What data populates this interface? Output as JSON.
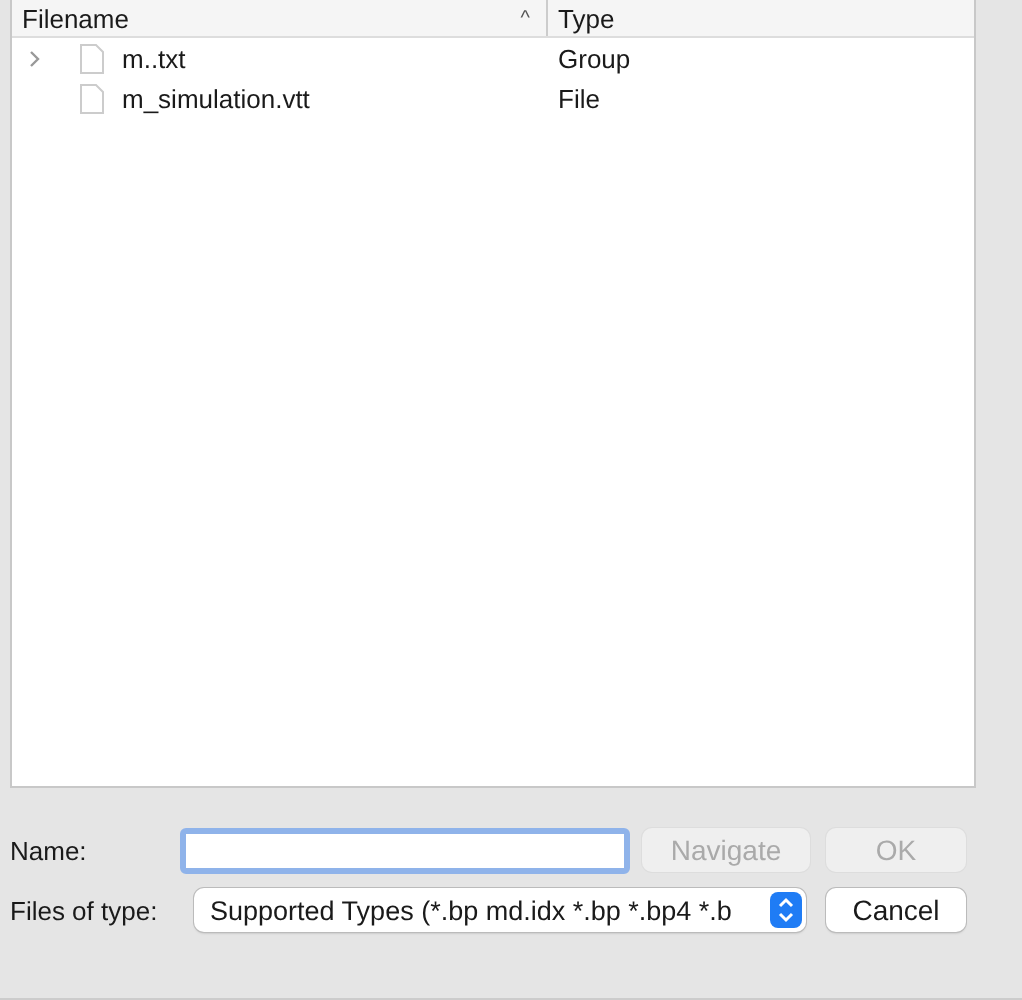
{
  "table": {
    "columns": [
      {
        "label": "Filename",
        "sort_glyph": "^"
      },
      {
        "label": "Type"
      }
    ],
    "rows": [
      {
        "name": "m..txt",
        "type": "Group",
        "expandable": true
      },
      {
        "name": "m_simulation.vtt",
        "type": "File",
        "expandable": false
      }
    ]
  },
  "name_field": {
    "label": "Name:",
    "focused": true
  },
  "file_type": {
    "label": "Files of type:",
    "value": "Supported Types (*.bp md.idx *.bp *.bp4 *.b"
  },
  "buttons": [
    {
      "label": "Navigate",
      "disabled": true
    },
    {
      "label": "OK",
      "disabled": true
    },
    {
      "label": "Cancel",
      "disabled": false
    }
  ]
}
